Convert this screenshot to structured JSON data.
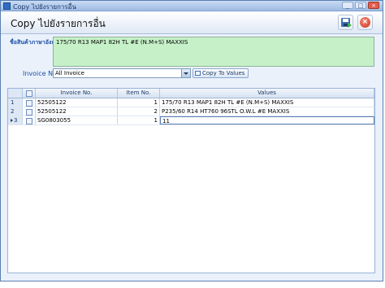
{
  "window": {
    "title": "Copy ไปยังรายการอื่น",
    "buttons": [
      "_",
      "□",
      "×"
    ]
  },
  "header": {
    "title": "Copy ไปยังรายการอื่น"
  },
  "form": {
    "product_label": "ชื่อสินค้าภาษาอังกฤษ",
    "product_value": "175/70 R13 MAP1 82H TL #E (N.M+S) MAXXIS",
    "invoice_label": "Invoice No",
    "invoice_value": "All Invoice",
    "copy_button": "Copy To Values"
  },
  "grid": {
    "columns": [
      "Invoice No.",
      "Item No.",
      "Values"
    ],
    "rows": [
      {
        "index": "1",
        "invoice": "52505122",
        "item": "1",
        "value": "175/70 R13 MAP1 82H TL #E (N.M+S) MAXXIS"
      },
      {
        "index": "2",
        "invoice": "52505122",
        "item": "2",
        "value": "P235/60 R14 HT760 96STL O.W.L #E MAXXIS"
      },
      {
        "index": "3",
        "invoice": "SG0803055",
        "item": "1",
        "value": "11"
      }
    ]
  }
}
